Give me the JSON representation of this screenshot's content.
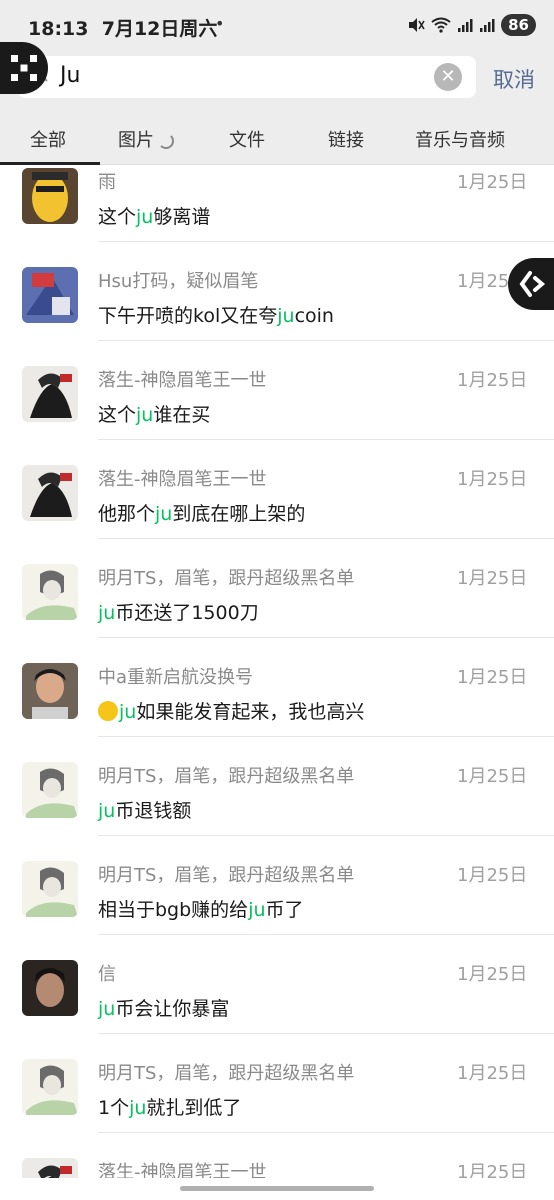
{
  "status_bar": {
    "time": "18:13",
    "date": "7月12日周六",
    "dot": "•",
    "battery": "86"
  },
  "search": {
    "query": "Ju",
    "cancel_label": "取消"
  },
  "tabs": [
    {
      "label": "全部",
      "active": true
    },
    {
      "label": "图片",
      "active": false,
      "loading": true
    },
    {
      "label": "文件",
      "active": false
    },
    {
      "label": "链接",
      "active": false
    },
    {
      "label": "音乐与音频",
      "active": false
    }
  ],
  "results": [
    {
      "name": "雨",
      "date": "1月25日",
      "pre": "这个",
      "hl": "ju",
      "post": "够离谱",
      "avatar": "avatar-yellow"
    },
    {
      "name": "Hsu打码，疑似眉笔",
      "date": "1月25日",
      "pre": "下午开喷的kol又在夸",
      "hl": "ju",
      "post": "coin",
      "avatar": "avatar-blue"
    },
    {
      "name": "落生-神隐眉笔王一世",
      "date": "1月25日",
      "pre": "这个",
      "hl": "ju",
      "post": "谁在买",
      "avatar": "avatar-dark"
    },
    {
      "name": "落生-神隐眉笔王一世",
      "date": "1月25日",
      "pre": "他那个",
      "hl": "ju",
      "post": "到底在哪上架的",
      "avatar": "avatar-dark"
    },
    {
      "name": "明月TS，眉笔，跟丹超级黑名单",
      "date": "1月25日",
      "pre": "",
      "hl": "ju",
      "post": "币还送了1500刀",
      "avatar": "avatar-sketch"
    },
    {
      "name": "中a重新启航没换号",
      "date": "1月25日",
      "pre": "",
      "hl": "ju",
      "post": "如果能发育起来，我也高兴",
      "avatar": "avatar-photo",
      "emoji": true
    },
    {
      "name": "明月TS，眉笔，跟丹超级黑名单",
      "date": "1月25日",
      "pre": "",
      "hl": "ju",
      "post": "币退钱额",
      "avatar": "avatar-sketch"
    },
    {
      "name": "明月TS，眉笔，跟丹超级黑名单",
      "date": "1月25日",
      "pre": "相当于bgb赚的给",
      "hl": "ju",
      "post": "币了",
      "avatar": "avatar-sketch"
    },
    {
      "name": "信",
      "date": "1月25日",
      "pre": "",
      "hl": "ju",
      "post": "币会让你暴富",
      "avatar": "avatar-man"
    },
    {
      "name": "明月TS，眉笔，跟丹超级黑名单",
      "date": "1月25日",
      "pre": "1个",
      "hl": "ju",
      "post": "就扎到低了",
      "avatar": "avatar-sketch"
    },
    {
      "name": "落生-神隐眉笔王一世",
      "date": "1月25日",
      "pre": "",
      "hl": "",
      "post": "",
      "avatar": "avatar-dark"
    }
  ],
  "colors": {
    "highlight": "#07c160",
    "cancel": "#576b95",
    "background": "#ededed"
  }
}
